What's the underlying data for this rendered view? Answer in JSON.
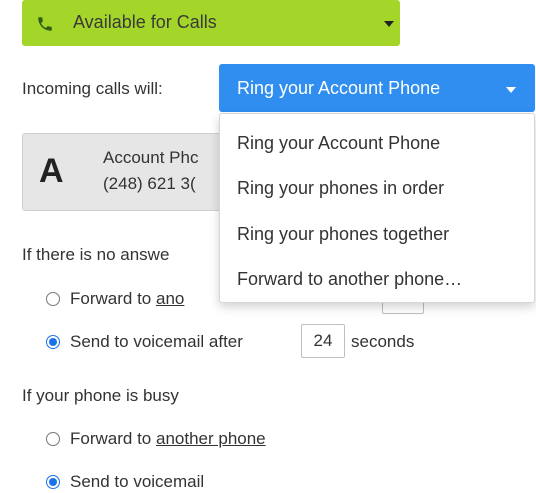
{
  "availability": {
    "label": "Available for Calls",
    "icon": "phone-icon",
    "bg_color": "#a4d629"
  },
  "incoming": {
    "label": "Incoming calls will:",
    "selected": "Ring your Account Phone",
    "accent": "#2f8ef0",
    "menu_items": [
      "Ring your Account Phone",
      "Ring your phones in order",
      "Ring your phones together",
      "Forward to another phone…"
    ]
  },
  "account_phone": {
    "letter": "A",
    "name_visible": "Account Phc",
    "number_visible": "(248) 621 3("
  },
  "no_answer": {
    "label": "If there is no answe",
    "forward": {
      "prefix": "Forward to ",
      "link_visible": "ano",
      "selected": false
    },
    "voicemail": {
      "prefix": "Send to voicemail after",
      "seconds": "24",
      "suffix": "seconds",
      "selected": true
    }
  },
  "busy": {
    "label": "If your phone is busy",
    "forward": {
      "prefix": "Forward to ",
      "link": "another phone",
      "selected": false
    },
    "voicemail": {
      "label": "Send to voicemail",
      "selected": true
    }
  }
}
